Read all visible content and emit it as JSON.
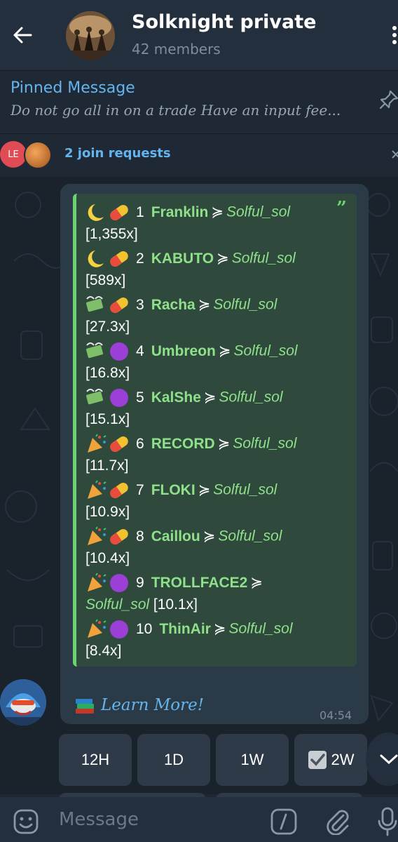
{
  "header": {
    "title": "Solknight private",
    "subtitle": "42 members"
  },
  "pinned": {
    "label": "Pinned Message",
    "text": "Do not go all in on a trade  Have an input fee..."
  },
  "join_requests": {
    "avatar_initials": "LE",
    "text": "2 join requests"
  },
  "message": {
    "entries": [
      {
        "rank": "1",
        "token": "Franklin",
        "arrow": "≽",
        "by": "Solful_sol",
        "mult": "[1,355x]",
        "emoji": "moon-pill"
      },
      {
        "rank": "2",
        "token": "KABUTO",
        "arrow": "≽",
        "by": "Solful_sol",
        "mult": "[589x]",
        "emoji": "moon-pill"
      },
      {
        "rank": "3",
        "token": "Racha",
        "arrow": "≽",
        "by": "Solful_sol",
        "mult": "[27.3x]",
        "emoji": "money-pill"
      },
      {
        "rank": "4",
        "token": "Umbreon",
        "arrow": "≽",
        "by": "Solful_sol",
        "mult": "[16.8x]",
        "emoji": "money-circle"
      },
      {
        "rank": "5",
        "token": "KalShe",
        "arrow": "≽",
        "by": "Solful_sol",
        "mult": "[15.1x]",
        "emoji": "money-circle"
      },
      {
        "rank": "6",
        "token": "RECORD",
        "arrow": "≽",
        "by": "Solful_sol",
        "mult": "[11.7x]",
        "emoji": "party-pill"
      },
      {
        "rank": "7",
        "token": "FLOKI",
        "arrow": "≽",
        "by": "Solful_sol",
        "mult": "[10.9x]",
        "emoji": "party-pill"
      },
      {
        "rank": "8",
        "token": "Caillou",
        "arrow": "≽",
        "by": "Solful_sol",
        "mult": "[10.4x]",
        "emoji": "party-pill"
      },
      {
        "rank": "9",
        "token": "TROLLFACE2",
        "arrow": "≽",
        "by": "Solful_sol",
        "mult": "[10.1x]",
        "emoji": "party-circle"
      },
      {
        "rank": "10",
        "token": "ThinAir",
        "arrow": "≽",
        "by": "Solful_sol",
        "mult": "[8.4x]",
        "emoji": "party-circle"
      }
    ],
    "learn_more": "Learn More!",
    "time": "04:54"
  },
  "keyboard": {
    "buttons": [
      "12H",
      "1D",
      "1W",
      "2W"
    ]
  },
  "input": {
    "placeholder": "Message"
  },
  "colors": {
    "accent": "#64b5ef",
    "quote_green": "#6bd36f",
    "bubble": "#2b3a47",
    "header": "#242f3d"
  },
  "icons": {
    "back": "arrow-left-icon",
    "more": "more-vertical-icon",
    "pin": "pin-icon",
    "close": "close-icon",
    "emoji": "emoji-icon",
    "command": "slash-command-icon",
    "attach": "paperclip-icon",
    "mic": "microphone-icon",
    "scroll": "chevron-down-icon"
  }
}
